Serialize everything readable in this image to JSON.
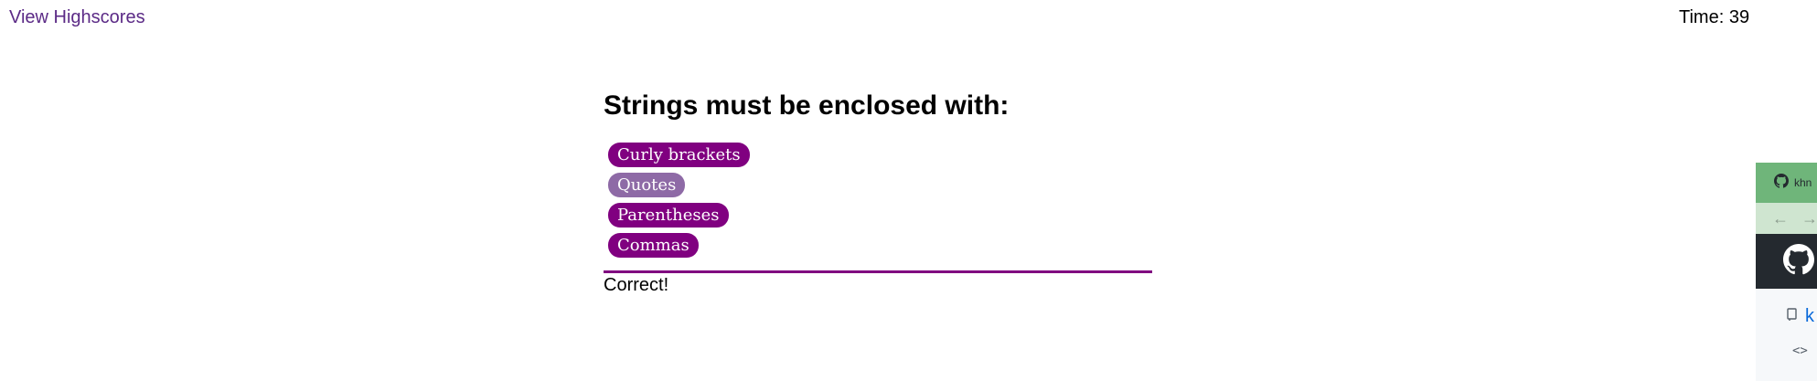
{
  "header": {
    "highscores_label": "View Highscores",
    "timer_text": "Time: 39"
  },
  "quiz": {
    "question": "Strings must be enclosed with:",
    "choices": [
      {
        "label": "Curly brackets"
      },
      {
        "label": "Quotes"
      },
      {
        "label": "Parentheses"
      },
      {
        "label": "Commas"
      }
    ],
    "feedback": "Correct!"
  },
  "side_window": {
    "tab_title": "khn",
    "repo_initial": "k",
    "code_icon_label": "<>"
  },
  "colors": {
    "accent": "#800080",
    "hover_choice": "#8e6aa6",
    "link": "#5b2a86",
    "side_tabbar": "#6fb57a",
    "side_header": "#24292f"
  }
}
